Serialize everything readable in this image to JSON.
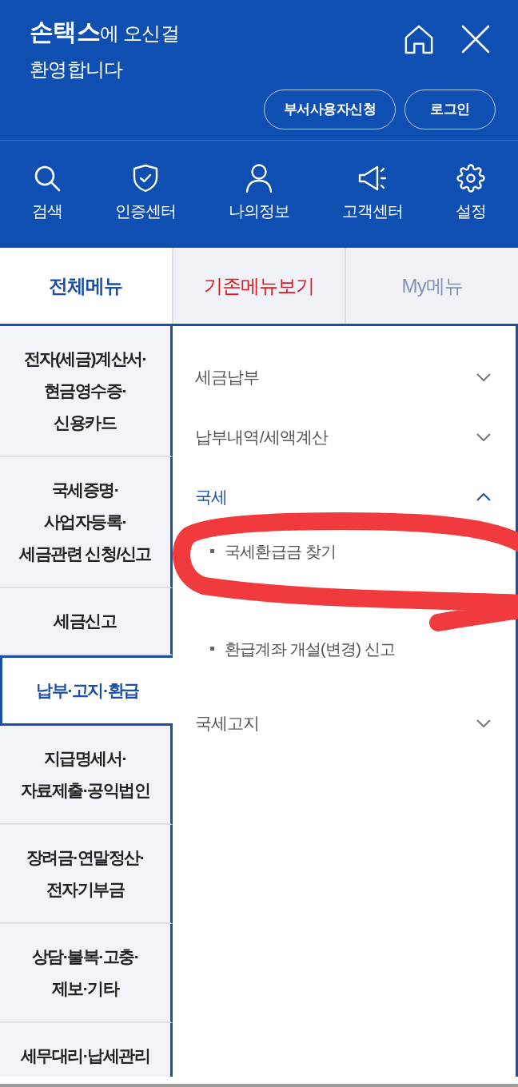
{
  "header": {
    "greeting": "**손택스**에 오신걸\n환영합니다",
    "buttons": [
      "부서사용자신청",
      "로그인"
    ]
  },
  "quick_menu": [
    {
      "label": "검색",
      "kind": "search"
    },
    {
      "label": "인증센터",
      "kind": "shield"
    },
    {
      "label": "나의정보",
      "kind": "person"
    },
    {
      "label": "고객센터",
      "kind": "megaphone"
    },
    {
      "label": "설정",
      "kind": "gear"
    }
  ],
  "tabs": [
    {
      "label": "전체메뉴",
      "selected": true,
      "highlight": false
    },
    {
      "label": "기존메뉴보기",
      "selected": false,
      "highlight": true
    },
    {
      "label": "My메뉴",
      "selected": false,
      "highlight": false
    }
  ],
  "categories": [
    {
      "label": "전자(세금)계산서·\n현금영수증·\n신용카드",
      "selected": false
    },
    {
      "label": "국세증명·\n사업자등록·\n세금관련 신청/신고",
      "selected": false
    },
    {
      "label": "세금신고",
      "selected": false
    },
    {
      "label": "납부·고지·환급",
      "selected": true
    },
    {
      "label": "지급명세서·\n자료제출·공익법인",
      "selected": false
    },
    {
      "label": "장려금·연말정산·\n전자기부금",
      "selected": false
    },
    {
      "label": "상담·불복·고충·\n제보·기타",
      "selected": false
    },
    {
      "label": "세무대리·납세관리",
      "selected": false
    }
  ],
  "submenu": [
    {
      "label": "세금납부",
      "expanded": false
    },
    {
      "label": "납부내역/세액계산",
      "expanded": false
    },
    {
      "label": "국세",
      "expanded": true,
      "children": [
        {
          "label": "국세환급금 찾기"
        },
        {
          "label": "환급계좌 개설(변경) 신고"
        }
      ]
    },
    {
      "label": "국세고지",
      "expanded": false
    }
  ],
  "annotation": {
    "kind": "freehand_loop"
  }
}
